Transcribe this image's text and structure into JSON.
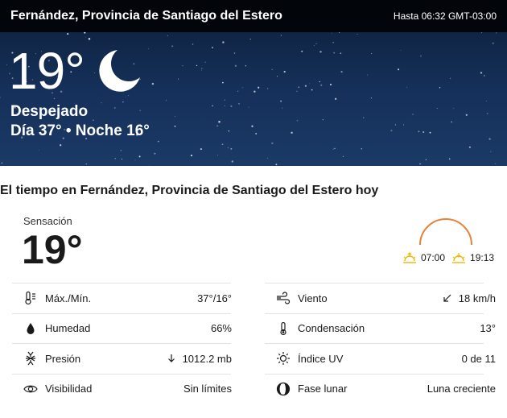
{
  "header": {
    "location": "Fernández, Provincia de Santiago del Estero",
    "valid_until": "Hasta 06:32 GMT-03:00"
  },
  "current": {
    "temperature": "19°",
    "condition": "Despejado",
    "day_night": "Día 37° • Noche 16°",
    "condition_icon": "moon-icon"
  },
  "today": {
    "title": "El tiempo en Fernández, Provincia de Santiago del Estero hoy",
    "feels_like_label": "Sensación",
    "feels_like_value": "19°",
    "sunrise": "07:00",
    "sunset": "19:13"
  },
  "details_left": [
    {
      "icon": "thermometer-icon",
      "label": "Máx./Mín.",
      "value": "37°/16°"
    },
    {
      "icon": "humidity-drop-icon",
      "label": "Humedad",
      "value": "66%"
    },
    {
      "icon": "pressure-icon",
      "label": "Presión",
      "value": "1012.2 mb"
    },
    {
      "icon": "eye-icon",
      "label": "Visibilidad",
      "value": "Sin límites"
    }
  ],
  "details_right": [
    {
      "icon": "wind-icon",
      "label": "Viento",
      "value": "18 km/h"
    },
    {
      "icon": "dew-point-icon",
      "label": "Condensación",
      "value": "13°"
    },
    {
      "icon": "uv-index-icon",
      "label": "Índice UV",
      "value": "0 de 11"
    },
    {
      "icon": "moon-phase-icon",
      "label": "Fase lunar",
      "value": "Luna creciente"
    }
  ],
  "colors": {
    "sun_arc": "#e8833a",
    "sun_icon": "#f2b705",
    "hero_bg": "#15305a"
  }
}
